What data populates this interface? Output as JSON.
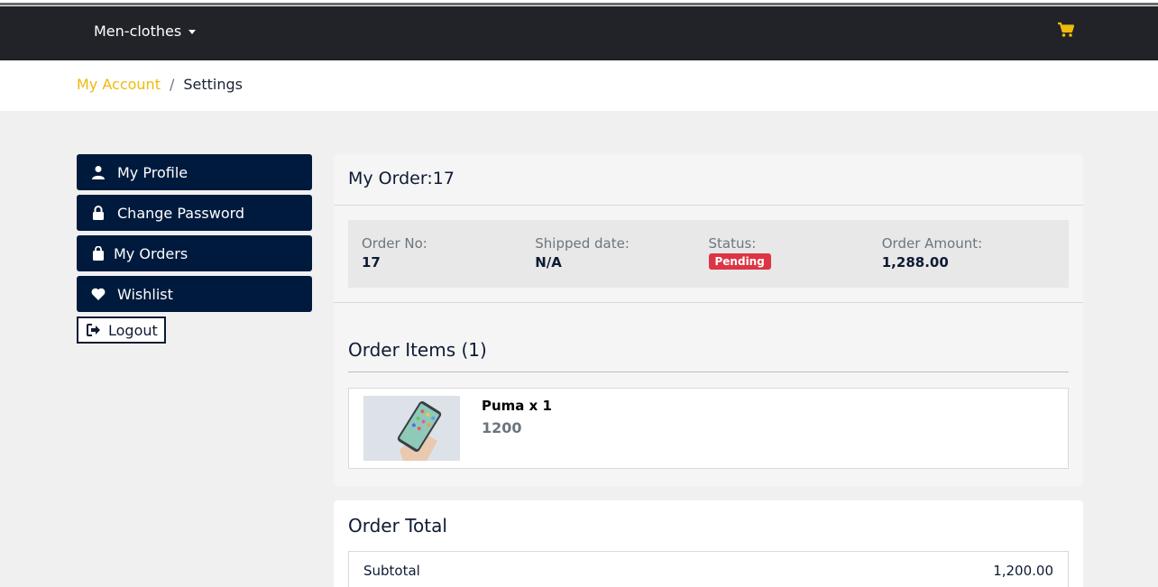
{
  "nav": {
    "menu_label": "Men-clothes"
  },
  "breadcrumb": {
    "account": "My Account",
    "separator": "/",
    "current": "Settings"
  },
  "sidebar": {
    "items": [
      {
        "label": "My Profile",
        "icon": "user-icon"
      },
      {
        "label": "Change Password",
        "icon": "lock-icon"
      },
      {
        "label": "My Orders",
        "icon": "shopping-bag-icon"
      },
      {
        "label": "Wishlist",
        "icon": "heart-icon"
      }
    ],
    "logout": "Logout"
  },
  "order": {
    "title": "My Order:17",
    "labels": {
      "order_no": "Order No:",
      "shipped": "Shipped date:",
      "status": "Status:",
      "amount": "Order Amount:"
    },
    "values": {
      "order_no": "17",
      "shipped": "N/A",
      "status": "Pending",
      "amount": "1,288.00"
    },
    "items_title": "Order Items (1)",
    "items": [
      {
        "name": "Puma x 1",
        "price": "1200"
      }
    ]
  },
  "total": {
    "title": "Order Total",
    "subtotal_label": "Subtotal",
    "subtotal_value": "1,200.00"
  },
  "colors": {
    "nav_bg": "#212329",
    "accent": "#f0b90b",
    "sidebar_btn": "#001a3d",
    "status_badge": "#dc3545"
  }
}
